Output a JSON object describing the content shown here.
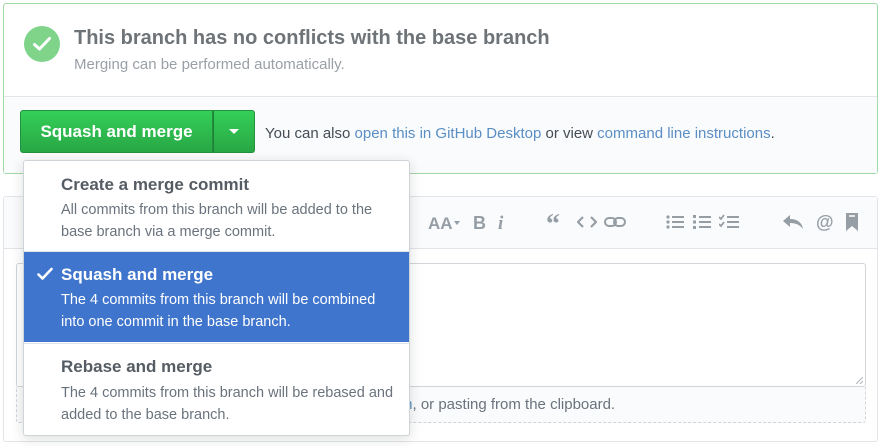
{
  "status": {
    "title": "This branch has no conflicts with the base branch",
    "subtitle": "Merging can be performed automatically."
  },
  "merge_button": {
    "label": "Squash and merge"
  },
  "also": {
    "prefix": "You can also ",
    "desktop_link": "open this in GitHub Desktop",
    "middle": " or view ",
    "cli_link": "command line instructions",
    "suffix": "."
  },
  "merge_options": [
    {
      "title": "Create a merge commit",
      "description": "All commits from this branch will be added to the base branch via a merge commit.",
      "selected": false
    },
    {
      "title": "Squash and merge",
      "description": "The 4 commits from this branch will be combined into one commit in the base branch.",
      "selected": true
    },
    {
      "title": "Rebase and merge",
      "description": "The 4 commits from this branch will be rebased and added to the base branch.",
      "selected": false
    }
  ],
  "editor": {
    "attach_link_fragment": "m",
    "attach_rest": ", or pasting from the clipboard."
  },
  "toolbar_icons": [
    "text-size-icon",
    "bold-icon",
    "italic-icon",
    "quote-icon",
    "code-icon",
    "link-icon",
    "bullet-list-icon",
    "numbered-list-icon",
    "task-list-icon",
    "reply-icon",
    "mention-icon",
    "bookmark-icon"
  ],
  "colors": {
    "merge_green": "#2ea44f",
    "selected_blue": "#3f75cc",
    "link_blue": "#5a8ec5",
    "success_border": "#a2d9a7"
  }
}
